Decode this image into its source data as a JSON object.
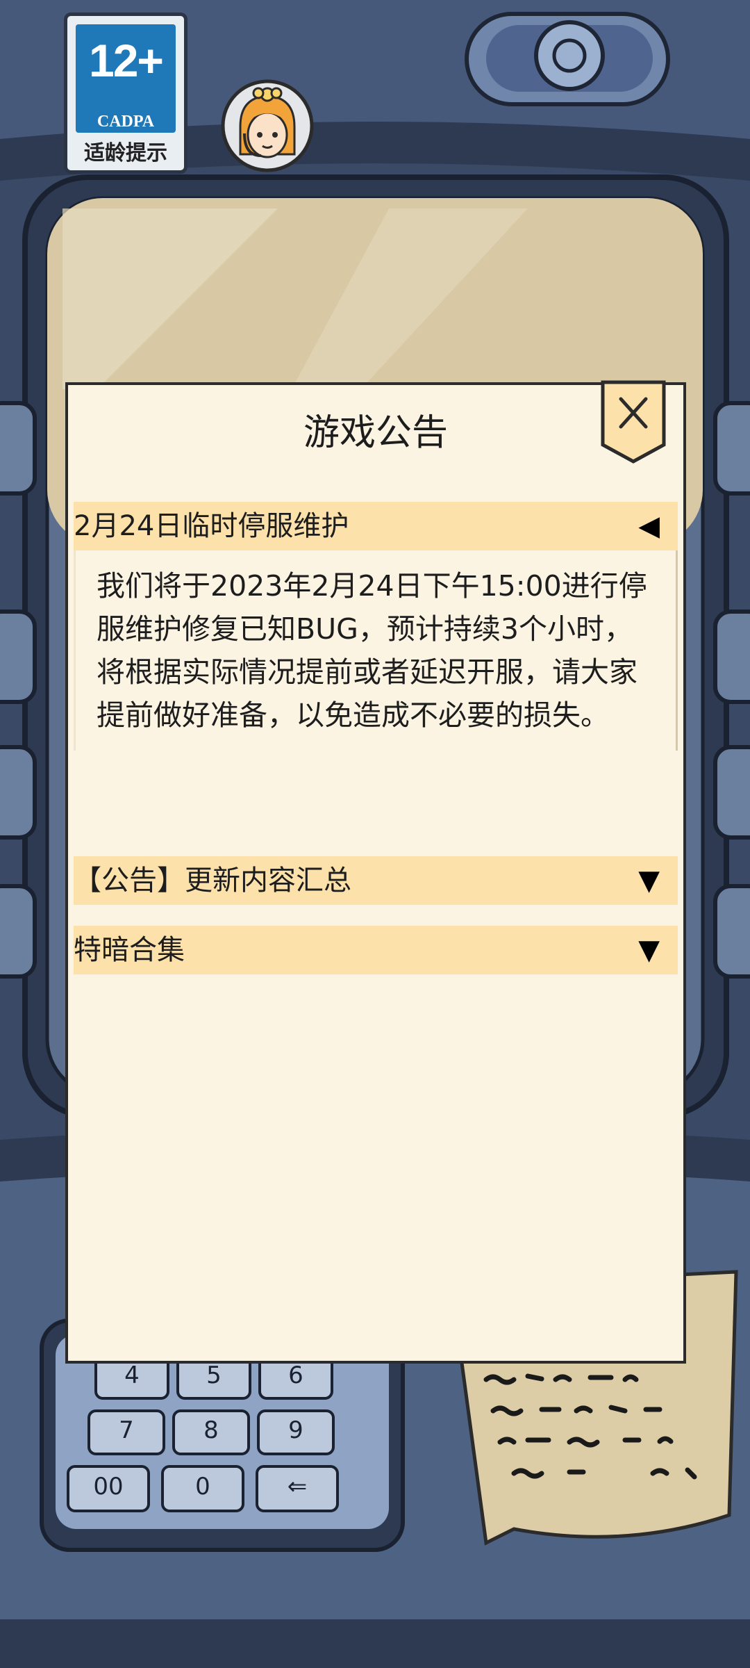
{
  "age_rating": {
    "number": "12+",
    "org": "CADPA",
    "label": "适龄提示"
  },
  "dialog": {
    "title": "游戏公告",
    "close_icon": "close-x-icon",
    "sections": [
      {
        "title": "2月24日临时停服维护",
        "arrow": "◀",
        "expanded": true,
        "body": "我们将于2023年2月24日下午15:00进行停服维护修复已知BUG，预计持续3个小时，将根据实际情况提前或者延迟开服，请大家提前做好准备，以免造成不必要的损失。"
      },
      {
        "title": "【公告】更新内容汇总",
        "arrow": "▼",
        "expanded": false
      },
      {
        "title": "特暗合集",
        "arrow": "▼",
        "expanded": false
      }
    ]
  },
  "keypad_keys": [
    "4",
    "5",
    "6",
    "7",
    "8",
    "9",
    "00",
    "0",
    "⇐"
  ],
  "colors": {
    "dialog_bg": "#fcf4e3",
    "section_header": "#fce1ab",
    "badge_blue": "#1f78b8",
    "machine_body": "#394a66"
  }
}
